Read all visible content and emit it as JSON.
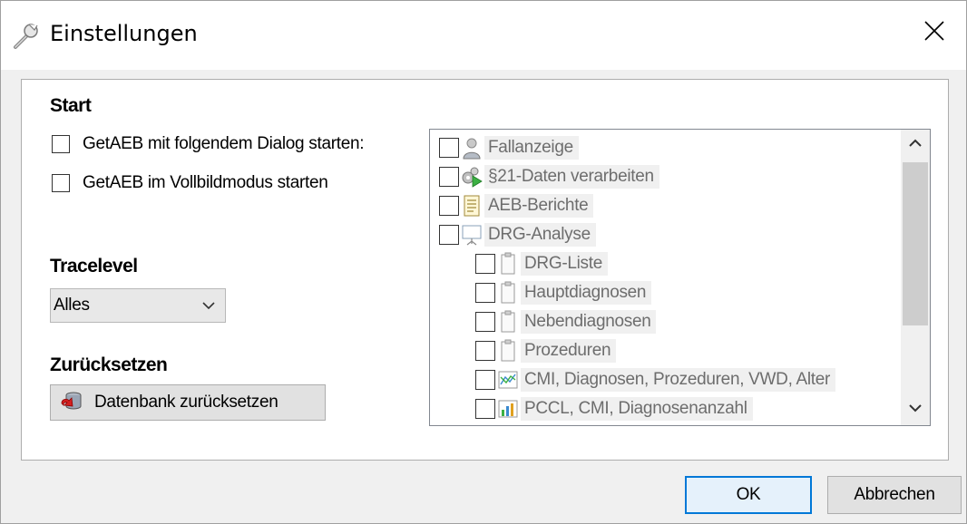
{
  "window": {
    "title": "Einstellungen",
    "icon": "wrench-icon",
    "close_icon": "close-icon"
  },
  "start": {
    "heading": "Start",
    "options": [
      {
        "label": "GetAEB mit folgendem Dialog starten:",
        "checked": false
      },
      {
        "label": "GetAEB im Vollbildmodus starten",
        "checked": false
      }
    ]
  },
  "trace": {
    "heading": "Tracelevel",
    "selected": "Alles"
  },
  "reset": {
    "heading": "Zurücksetzen",
    "button_label": "Datenbank zurücksetzen",
    "button_icon": "database-reset-icon"
  },
  "tree": {
    "items": [
      {
        "label": "Fallanzeige",
        "icon": "user-icon",
        "level": 0,
        "checked": false
      },
      {
        "label": "§21-Daten verarbeiten",
        "icon": "gears-play-icon",
        "level": 0,
        "checked": false
      },
      {
        "label": "AEB-Berichte",
        "icon": "report-icon",
        "level": 0,
        "checked": false
      },
      {
        "label": "DRG-Analyse",
        "icon": "presentation-icon",
        "level": 0,
        "checked": false
      },
      {
        "label": "DRG-Liste",
        "icon": "clipboard-icon",
        "level": 1,
        "checked": false
      },
      {
        "label": "Hauptdiagnosen",
        "icon": "clipboard-icon",
        "level": 1,
        "checked": false
      },
      {
        "label": "Nebendiagnosen",
        "icon": "clipboard-icon",
        "level": 1,
        "checked": false
      },
      {
        "label": "Prozeduren",
        "icon": "clipboard-icon",
        "level": 1,
        "checked": false
      },
      {
        "label": "CMI, Diagnosen, Prozeduren, VWD, Alter",
        "icon": "line-chart-icon",
        "level": 1,
        "checked": false
      },
      {
        "label": "PCCL, CMI, Diagnosenanzahl",
        "icon": "bar-chart-icon",
        "level": 1,
        "checked": false
      }
    ]
  },
  "buttons": {
    "ok": "OK",
    "cancel": "Abbrechen"
  },
  "colors": {
    "accent": "#0078d7",
    "window_bg": "#f0f0f0",
    "label_disabled": "#6d6d6d"
  }
}
